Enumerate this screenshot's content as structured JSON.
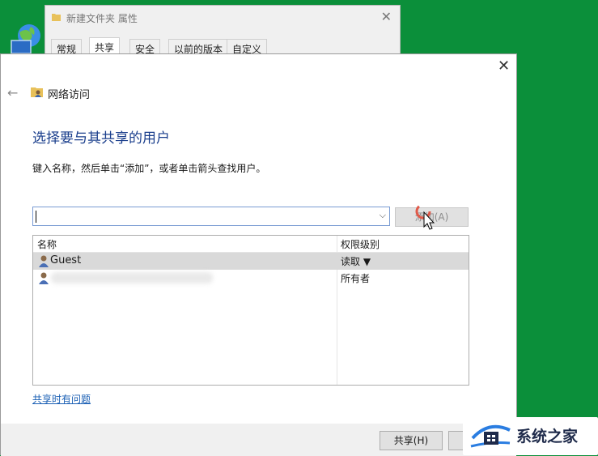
{
  "props_window": {
    "title": "新建文件夹 属性",
    "tabs": [
      "常规",
      "共享",
      "安全",
      "以前的版本",
      "自定义"
    ]
  },
  "dialog": {
    "nav_title": "网络访问",
    "heading": "选择要与其共享的用户",
    "instruction": "键入名称，然后单击“添加”，或者单击箭头查找用户。",
    "name_input": {
      "value": "",
      "placeholder": ""
    },
    "add_button_label": "添加(A)",
    "list": {
      "columns": [
        "名称",
        "权限级别"
      ],
      "rows": [
        {
          "name": "Guest",
          "permission": "读取 ▼",
          "selected": true
        },
        {
          "name": "",
          "permission": "所有者",
          "selected": false
        }
      ]
    },
    "problem_link": "共享时有问题",
    "share_button_label": "共享(H)"
  },
  "watermark": {
    "text": "系统之家"
  },
  "colors": {
    "desktop": "#0b8f3a",
    "heading": "#1a3e8c",
    "link": "#1a5fb4",
    "selection": "#d9d9d9"
  }
}
